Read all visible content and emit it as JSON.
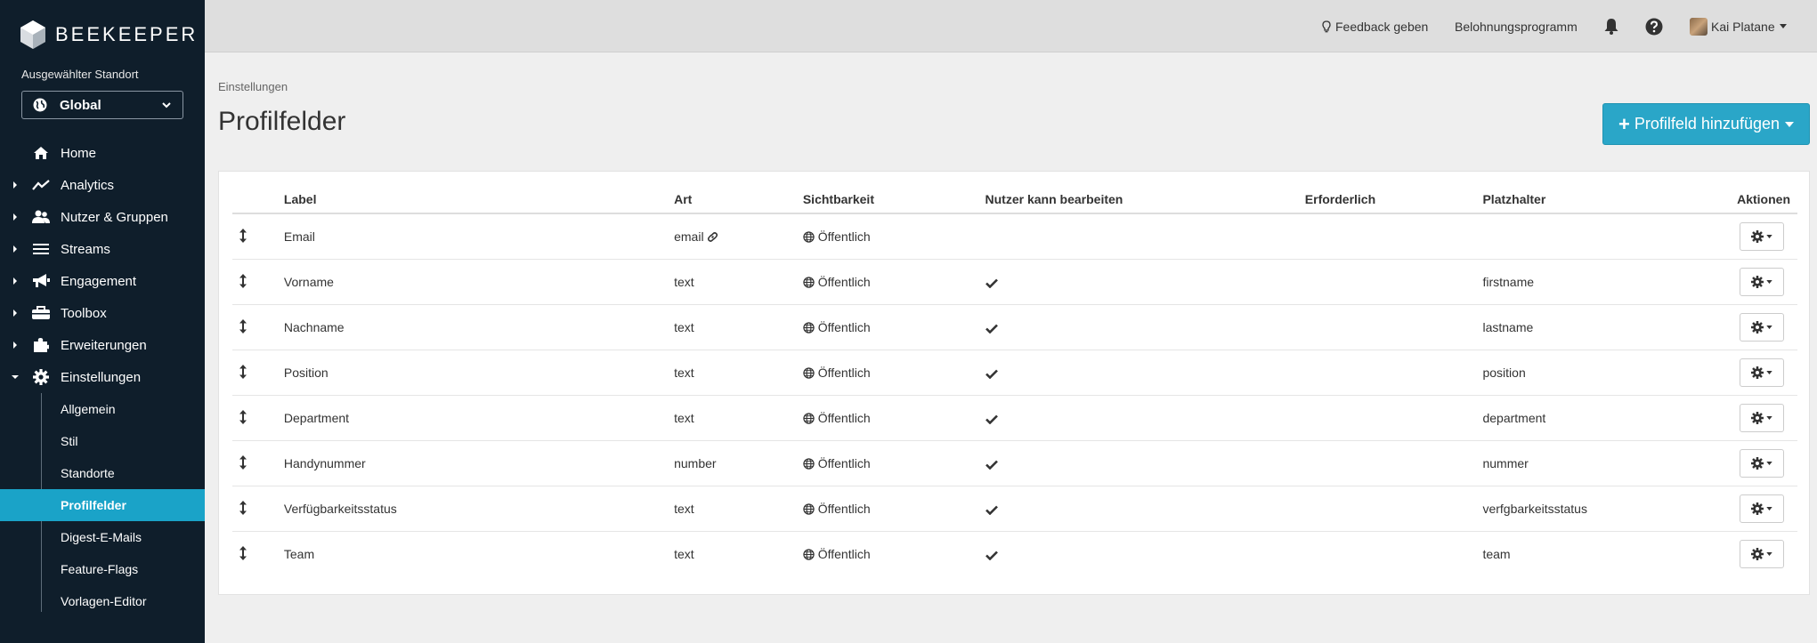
{
  "app": {
    "brand": "BEEKEEPER"
  },
  "location": {
    "label": "Ausgewählter Standort",
    "value": "Global"
  },
  "nav": {
    "items": [
      {
        "label": "Home",
        "icon": "home-icon",
        "expandable": false
      },
      {
        "label": "Analytics",
        "icon": "chart-line-icon",
        "expandable": true
      },
      {
        "label": "Nutzer & Gruppen",
        "icon": "users-icon",
        "expandable": true
      },
      {
        "label": "Streams",
        "icon": "list-icon",
        "expandable": true
      },
      {
        "label": "Engagement",
        "icon": "megaphone-icon",
        "expandable": true
      },
      {
        "label": "Toolbox",
        "icon": "toolbox-icon",
        "expandable": true
      },
      {
        "label": "Erweiterungen",
        "icon": "puzzle-icon",
        "expandable": true
      },
      {
        "label": "Einstellungen",
        "icon": "gear-icon",
        "expandable": true,
        "expanded": true
      }
    ],
    "subitems": [
      {
        "label": "Allgemein"
      },
      {
        "label": "Stil"
      },
      {
        "label": "Standorte"
      },
      {
        "label": "Profilfelder",
        "active": true
      },
      {
        "label": "Digest-E-Mails"
      },
      {
        "label": "Feature-Flags"
      },
      {
        "label": "Vorlagen-Editor"
      }
    ]
  },
  "topbar": {
    "feedback": "Feedback geben",
    "rewards": "Belohnungsprogramm",
    "user": "Kai Platane"
  },
  "page": {
    "breadcrumb": "Einstellungen",
    "title": "Profilfelder",
    "add_button": "Profilfeld hinzufügen"
  },
  "table": {
    "headers": {
      "label": "Label",
      "art": "Art",
      "visibility": "Sichtbarkeit",
      "editable": "Nutzer kann bearbeiten",
      "required": "Erforderlich",
      "placeholder": "Platzhalter",
      "actions": "Aktionen"
    },
    "rows": [
      {
        "label": "Email",
        "art": "email",
        "art_link": true,
        "visibility": "Öffentlich",
        "editable": false,
        "required": false,
        "placeholder": ""
      },
      {
        "label": "Vorname",
        "art": "text",
        "visibility": "Öffentlich",
        "editable": true,
        "required": false,
        "placeholder": "firstname"
      },
      {
        "label": "Nachname",
        "art": "text",
        "visibility": "Öffentlich",
        "editable": true,
        "required": false,
        "placeholder": "lastname"
      },
      {
        "label": "Position",
        "art": "text",
        "visibility": "Öffentlich",
        "editable": true,
        "required": false,
        "placeholder": "position"
      },
      {
        "label": "Department",
        "art": "text",
        "visibility": "Öffentlich",
        "editable": true,
        "required": false,
        "placeholder": "department"
      },
      {
        "label": "Handynummer",
        "art": "number",
        "visibility": "Öffentlich",
        "editable": true,
        "required": false,
        "placeholder": "nummer"
      },
      {
        "label": "Verfügbarkeitsstatus",
        "art": "text",
        "visibility": "Öffentlich",
        "editable": true,
        "required": false,
        "placeholder": "verfgbarkeitsstatus"
      },
      {
        "label": "Team",
        "art": "text",
        "visibility": "Öffentlich",
        "editable": true,
        "required": false,
        "placeholder": "team"
      }
    ]
  },
  "colors": {
    "sidebar": "#0f1e2b",
    "accent": "#1aa3c8",
    "button": "#2aa6c8"
  }
}
